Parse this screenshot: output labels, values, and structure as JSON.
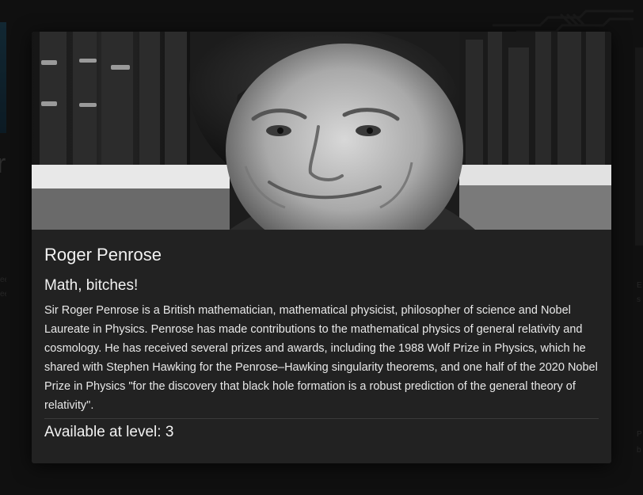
{
  "modal": {
    "name": "Roger Penrose",
    "tagline": "Math, bitches!",
    "description": "Sir Roger Penrose is a British mathematician, mathematical physicist, philosopher of science and Nobel Laureate in Physics. Penrose has made contributions to the mathematical physics of general relativity and cosmology. He has received several prizes and awards, including the 1988 Wolf Prize in Physics, which he shared with Stephen Hawking for the Penrose–Hawking singularity theorems, and one half of the 2020 Nobel Prize in Physics \"for the discovery that black hole formation is a robust prediction of the general theory of relativity\".",
    "level_label": "Available at level:",
    "level_value": "3",
    "portrait_icon": "portrait-photo"
  },
  "colors": {
    "page_background": "#1a1a1a",
    "modal_background": "#222222",
    "text": "#f2f2f2",
    "divider": "#3a3a3a"
  }
}
